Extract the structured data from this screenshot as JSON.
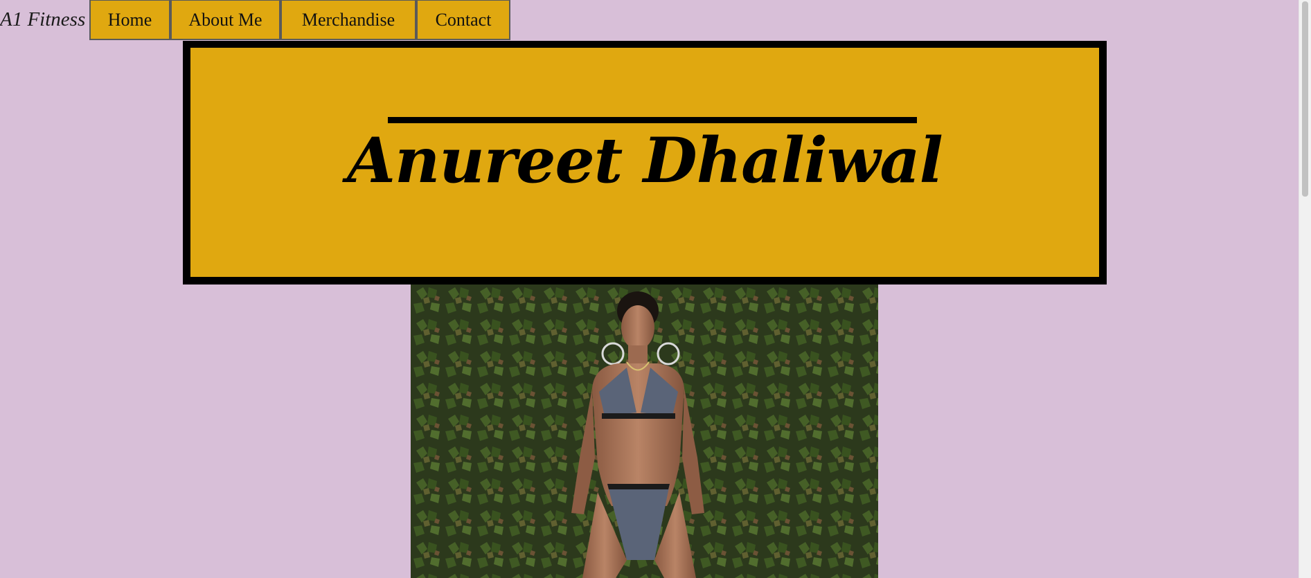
{
  "brand": {
    "text": "A1 Fitness"
  },
  "nav": {
    "home": "Home",
    "about": "About Me",
    "merchandise": "Merchandise",
    "contact": "Contact"
  },
  "banner": {
    "title": "Anureet Dhaliwal"
  },
  "hero_photo": {
    "subject": "portrait-photo"
  },
  "colors": {
    "background": "#d8bfd8",
    "accent": "#e0a810",
    "border": "#000000"
  }
}
